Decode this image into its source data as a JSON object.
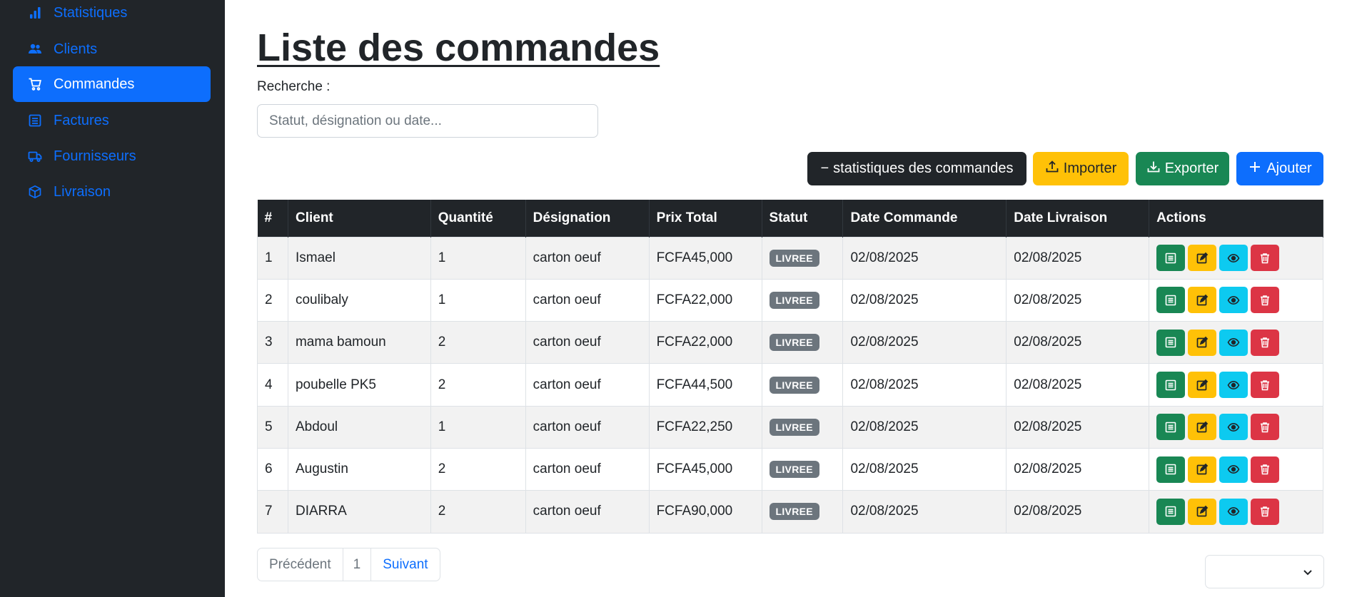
{
  "sidebar": {
    "items": [
      {
        "label": "Statistiques",
        "icon": "bar-chart-icon"
      },
      {
        "label": "Clients",
        "icon": "users-icon"
      },
      {
        "label": "Commandes",
        "icon": "cart-icon",
        "active": true
      },
      {
        "label": "Factures",
        "icon": "invoice-icon"
      },
      {
        "label": "Fournisseurs",
        "icon": "truck-icon"
      },
      {
        "label": "Livraison",
        "icon": "box-icon"
      }
    ]
  },
  "main": {
    "title": "Liste des commandes",
    "search": {
      "label": "Recherche :",
      "placeholder": "Statut, désignation ou date...",
      "value": ""
    },
    "toolbar": {
      "stats_label": "statistiques des commandes",
      "import_label": "Importer",
      "export_label": "Exporter",
      "add_label": "Ajouter"
    },
    "table": {
      "headers": [
        "#",
        "Client",
        "Quantité",
        "Désignation",
        "Prix Total",
        "Statut",
        "Date Commande",
        "Date Livraison",
        "Actions"
      ],
      "rows": [
        {
          "id": "1",
          "client": "Ismael",
          "qty": "1",
          "designation": "carton oeuf",
          "price": "FCFA45,000",
          "status": "LIVREE",
          "date_cmd": "02/08/2025",
          "date_liv": "02/08/2025"
        },
        {
          "id": "2",
          "client": "coulibaly",
          "qty": "1",
          "designation": "carton oeuf",
          "price": "FCFA22,000",
          "status": "LIVREE",
          "date_cmd": "02/08/2025",
          "date_liv": "02/08/2025"
        },
        {
          "id": "3",
          "client": "mama bamoun",
          "qty": "2",
          "designation": "carton oeuf",
          "price": "FCFA22,000",
          "status": "LIVREE",
          "date_cmd": "02/08/2025",
          "date_liv": "02/08/2025"
        },
        {
          "id": "4",
          "client": "poubelle PK5",
          "qty": "2",
          "designation": "carton oeuf",
          "price": "FCFA44,500",
          "status": "LIVREE",
          "date_cmd": "02/08/2025",
          "date_liv": "02/08/2025"
        },
        {
          "id": "5",
          "client": "Abdoul",
          "qty": "1",
          "designation": "carton oeuf",
          "price": "FCFA22,250",
          "status": "LIVREE",
          "date_cmd": "02/08/2025",
          "date_liv": "02/08/2025"
        },
        {
          "id": "6",
          "client": "Augustin",
          "qty": "2",
          "designation": "carton oeuf",
          "price": "FCFA45,000",
          "status": "LIVREE",
          "date_cmd": "02/08/2025",
          "date_liv": "02/08/2025"
        },
        {
          "id": "7",
          "client": "DIARRA",
          "qty": "2",
          "designation": "carton oeuf",
          "price": "FCFA90,000",
          "status": "LIVREE",
          "date_cmd": "02/08/2025",
          "date_liv": "02/08/2025"
        }
      ]
    },
    "pagination": {
      "prev_label": "Précédent",
      "current_page": "1",
      "next_label": "Suivant"
    },
    "page_size_select": {
      "value": ""
    }
  },
  "colors": {
    "sidebar_bg": "#212529",
    "primary": "#0d6efd",
    "success": "#198754",
    "warning": "#ffc107",
    "info": "#0dcaf0",
    "danger": "#dc3545",
    "secondary": "#6c757d"
  }
}
